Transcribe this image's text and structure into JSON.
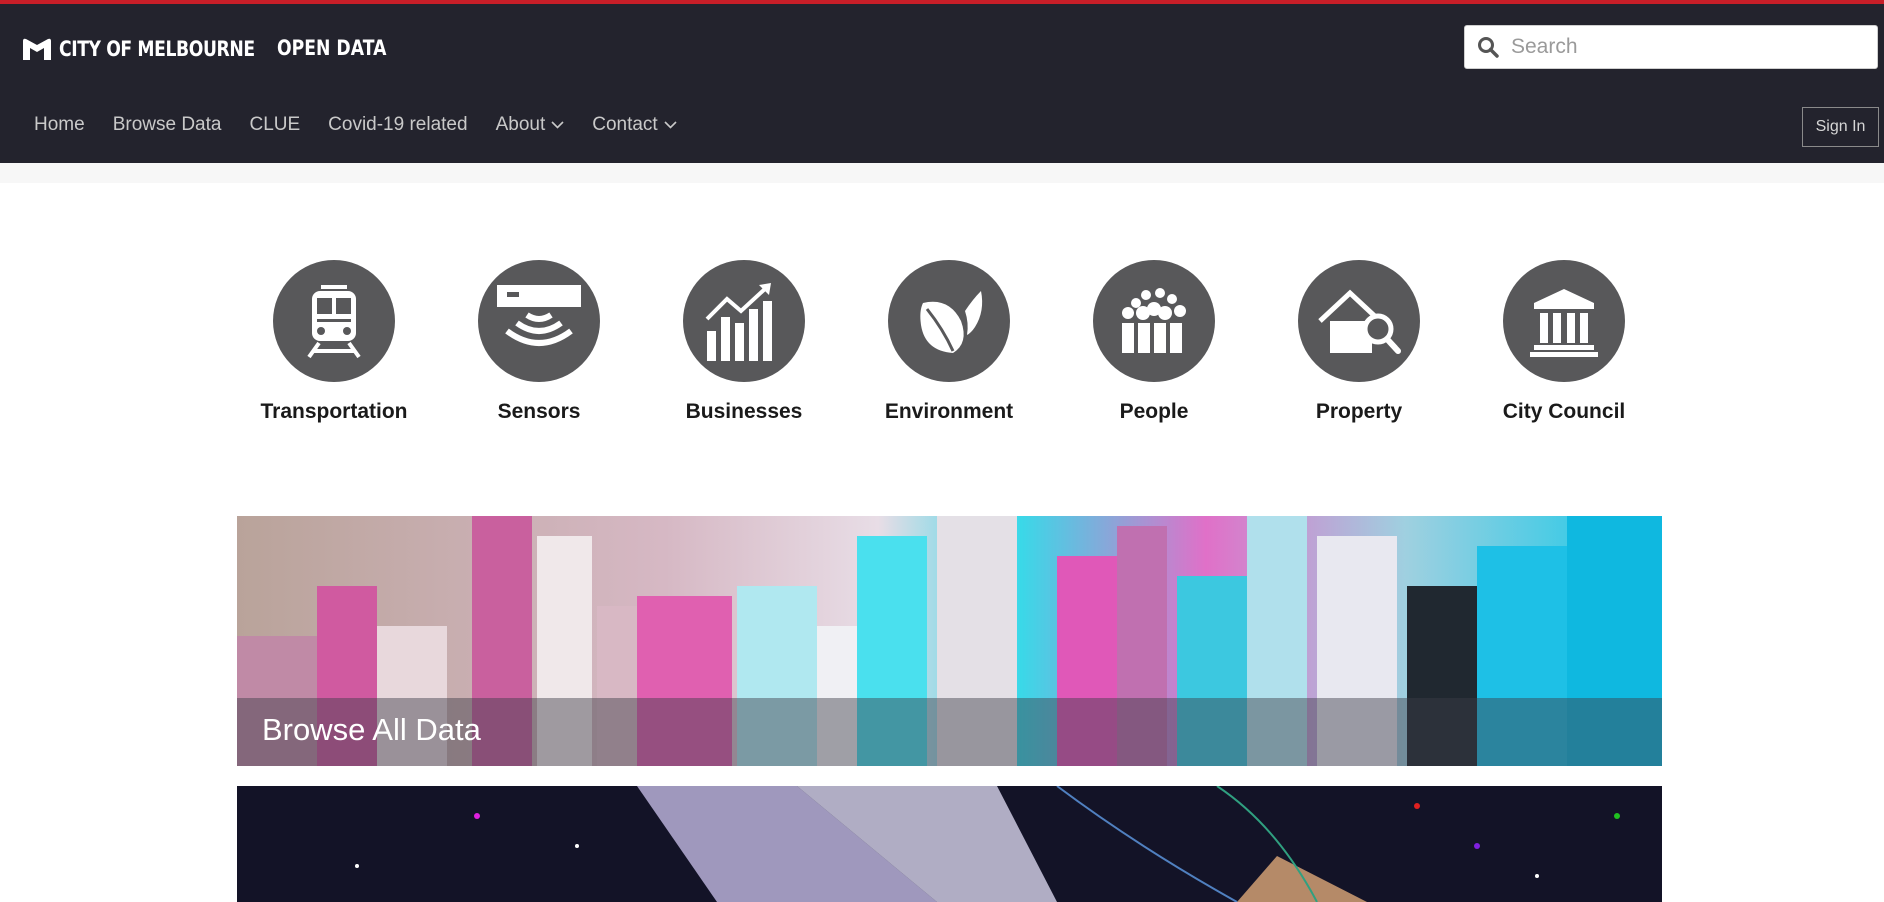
{
  "header": {
    "logo_text": "CITY OF MELBOURNE",
    "site_name": "OPEN DATA",
    "search_placeholder": "Search",
    "sign_in": "Sign In",
    "accent_color": "#c81e28",
    "bar_color": "#23232d"
  },
  "nav": [
    {
      "label": "Home",
      "dropdown": false
    },
    {
      "label": "Browse Data",
      "dropdown": false
    },
    {
      "label": "CLUE",
      "dropdown": false
    },
    {
      "label": "Covid-19 related",
      "dropdown": false
    },
    {
      "label": "About",
      "dropdown": true
    },
    {
      "label": "Contact",
      "dropdown": true
    }
  ],
  "categories": [
    {
      "label": "Transportation",
      "icon": "train-icon"
    },
    {
      "label": "Sensors",
      "icon": "sensor-icon"
    },
    {
      "label": "Businesses",
      "icon": "bar-chart-icon"
    },
    {
      "label": "Environment",
      "icon": "leaf-icon"
    },
    {
      "label": "People",
      "icon": "people-icon"
    },
    {
      "label": "Property",
      "icon": "house-search-icon"
    },
    {
      "label": "City Council",
      "icon": "building-columns-icon"
    }
  ],
  "banners": {
    "browse_all": "Browse All Data"
  }
}
